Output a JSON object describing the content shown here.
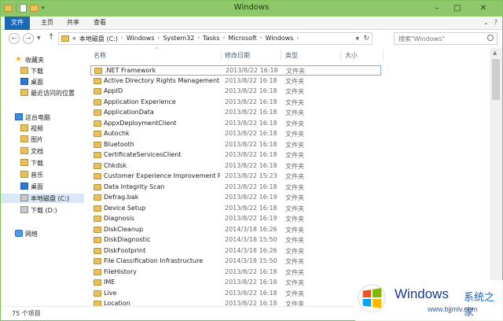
{
  "window": {
    "title": "Windows"
  },
  "ribbon": {
    "tabs": [
      {
        "label": "文件"
      },
      {
        "label": "主页"
      },
      {
        "label": "共享"
      },
      {
        "label": "查看"
      }
    ],
    "expand_icon": "chevron-down-icon",
    "help_icon": "help-icon"
  },
  "address": {
    "prefix": "«",
    "crumbs": [
      "本地磁盘 (C:)",
      "Windows",
      "System32",
      "Tasks",
      "Microsoft",
      "Windows"
    ]
  },
  "search": {
    "placeholder": "搜索\"Windows\""
  },
  "nav": {
    "items": [
      {
        "label": "收藏夹",
        "icon": "star-icon"
      },
      {
        "label": "下载",
        "icon": "download-folder-icon"
      },
      {
        "label": "桌面",
        "icon": "desktop-icon"
      },
      {
        "label": "最近访问的位置",
        "icon": "recent-places-icon"
      },
      {
        "label": "这台电脑",
        "icon": "computer-icon"
      },
      {
        "label": "视频",
        "icon": "videos-folder-icon"
      },
      {
        "label": "图片",
        "icon": "pictures-folder-icon"
      },
      {
        "label": "文档",
        "icon": "documents-folder-icon"
      },
      {
        "label": "下载",
        "icon": "download-folder-icon"
      },
      {
        "label": "音乐",
        "icon": "music-folder-icon"
      },
      {
        "label": "桌面",
        "icon": "desktop-icon"
      },
      {
        "label": "本地磁盘 (C:)",
        "icon": "drive-icon"
      },
      {
        "label": "下载 (D:)",
        "icon": "drive-icon"
      },
      {
        "label": "网络",
        "icon": "network-icon"
      }
    ]
  },
  "columns": {
    "name": "名称",
    "date": "修改日期",
    "type": "类型",
    "size": "大小"
  },
  "files": [
    {
      "name": ".NET Framework",
      "date": "2013/8/22 16:18",
      "type": "文件夹"
    },
    {
      "name": "Active Directory Rights Management ...",
      "date": "2013/8/22 16:18",
      "type": "文件夹"
    },
    {
      "name": "AppID",
      "date": "2013/8/22 16:18",
      "type": "文件夹"
    },
    {
      "name": "Application Experience",
      "date": "2013/8/22 16:18",
      "type": "文件夹"
    },
    {
      "name": "ApplicationData",
      "date": "2013/8/22 16:18",
      "type": "文件夹"
    },
    {
      "name": "AppxDeploymentClient",
      "date": "2013/8/22 16:18",
      "type": "文件夹"
    },
    {
      "name": "Autochk",
      "date": "2013/8/22 16:18",
      "type": "文件夹"
    },
    {
      "name": "Bluetooth",
      "date": "2013/8/22 16:18",
      "type": "文件夹"
    },
    {
      "name": "CertificateServicesClient",
      "date": "2013/8/22 16:18",
      "type": "文件夹"
    },
    {
      "name": "Chkdsk",
      "date": "2013/8/22 16:18",
      "type": "文件夹"
    },
    {
      "name": "Customer Experience Improvement P...",
      "date": "2013/8/22 15:23",
      "type": "文件夹"
    },
    {
      "name": "Data Integrity Scan",
      "date": "2013/8/22 16:18",
      "type": "文件夹"
    },
    {
      "name": "Defrag.bak",
      "date": "2013/8/22 16:19",
      "type": "文件夹"
    },
    {
      "name": "Device Setup",
      "date": "2013/8/22 16:18",
      "type": "文件夹"
    },
    {
      "name": "Diagnosis",
      "date": "2013/8/22 16:19",
      "type": "文件夹"
    },
    {
      "name": "DiskCleanup",
      "date": "2014/3/18 16:26",
      "type": "文件夹"
    },
    {
      "name": "DiskDiagnostic",
      "date": "2014/3/18 15:50",
      "type": "文件夹"
    },
    {
      "name": "DiskFootprint",
      "date": "2014/3/18 16:26",
      "type": "文件夹"
    },
    {
      "name": "File Classification Infrastructure",
      "date": "2014/3/18 15:50",
      "type": "文件夹"
    },
    {
      "name": "FileHistory",
      "date": "2013/8/22 16:18",
      "type": "文件夹"
    },
    {
      "name": "IME",
      "date": "2013/8/22 16:18",
      "type": "文件夹"
    },
    {
      "name": "Live",
      "date": "2013/8/22 16:18",
      "type": "文件夹"
    },
    {
      "name": "Location",
      "date": "2013/8/22 16:18",
      "type": "文件夹"
    }
  ],
  "status": {
    "count_text": "75 个项目"
  },
  "watermark": {
    "title": "Windows",
    "title_cn": "系统之家",
    "url": "www.bjjmlv.com"
  },
  "colors": {
    "titlebar": "#8ec86a",
    "file_tab": "#1a68b8",
    "folder": "#e8c15a",
    "selection": "#d9e8f7"
  }
}
